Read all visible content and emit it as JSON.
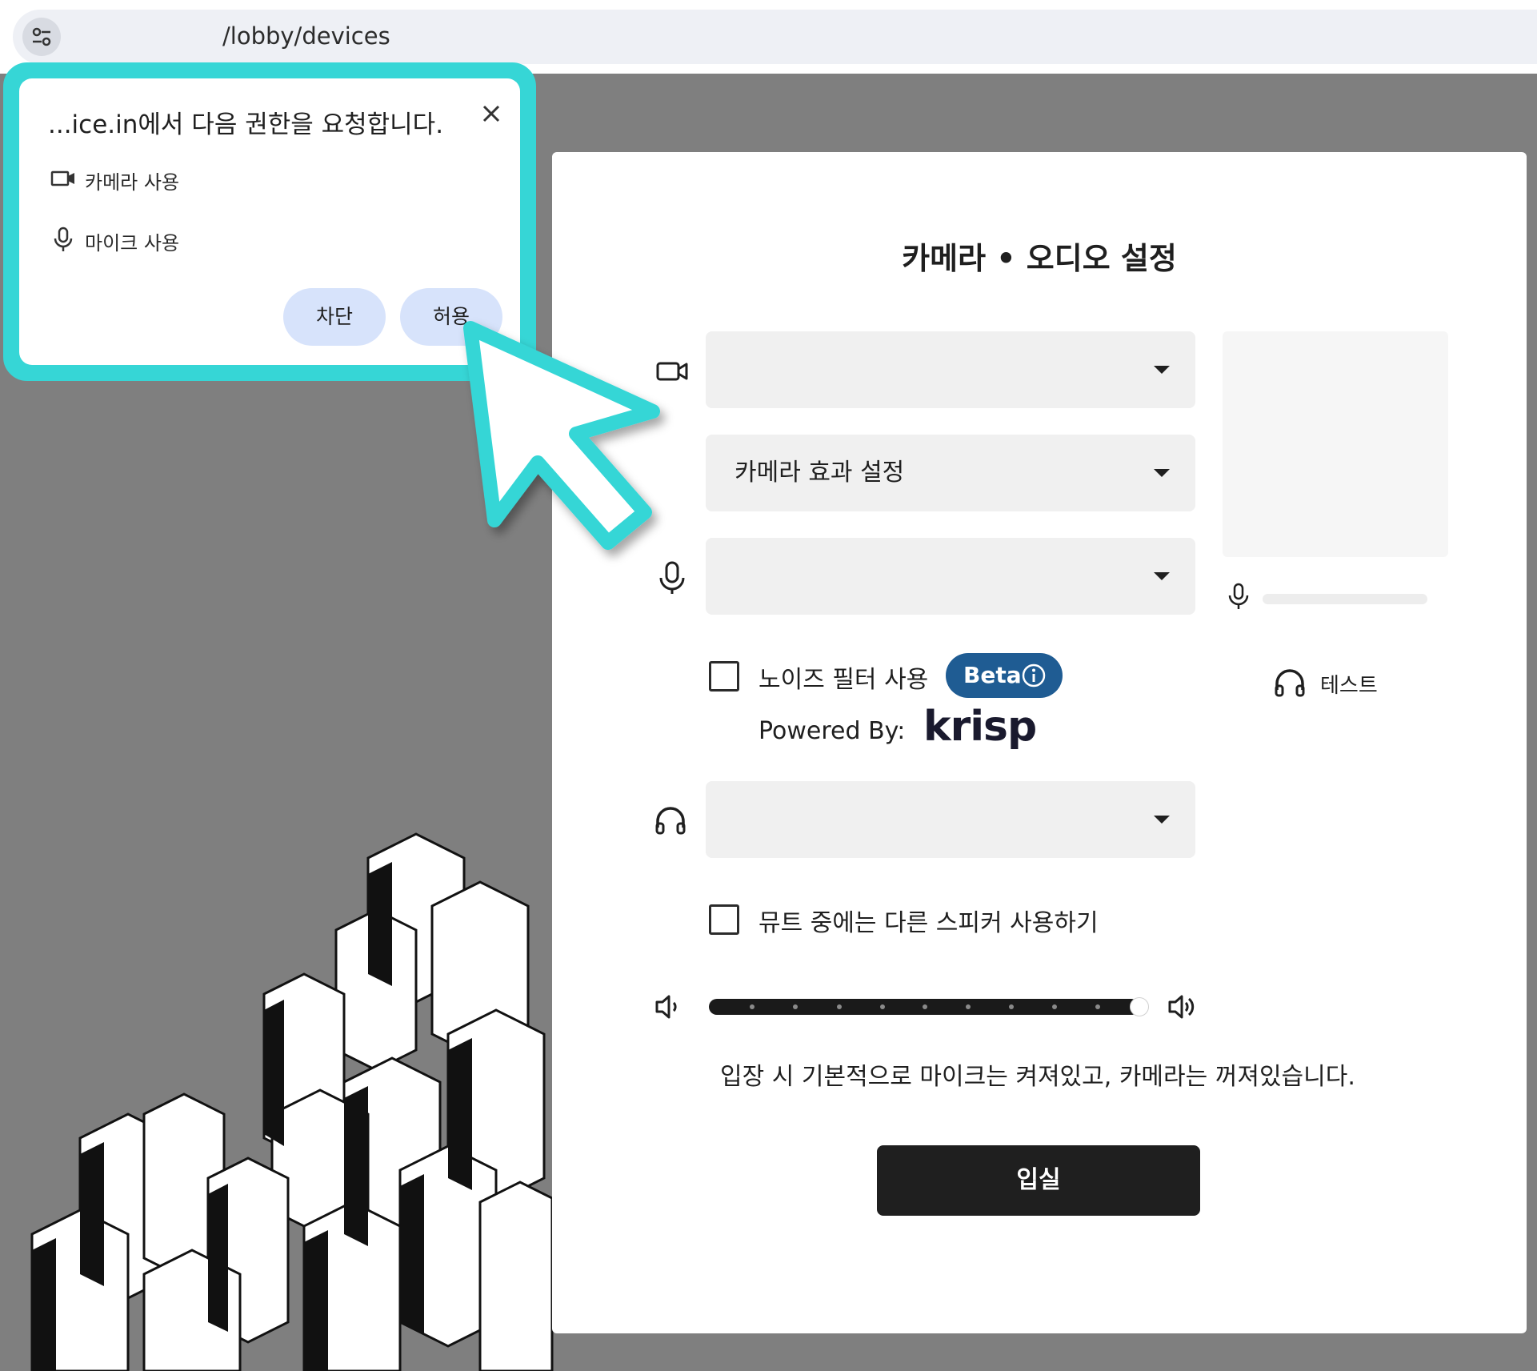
{
  "browser": {
    "url": "/lobby/devices"
  },
  "permission_popup": {
    "title": "...ice.in에서 다음 권한을 요청합니다.",
    "items": [
      {
        "label": "카메라 사용",
        "icon": "video-camera-icon"
      },
      {
        "label": "마이크 사용",
        "icon": "microphone-icon"
      }
    ],
    "block_label": "차단",
    "allow_label": "허용",
    "highlight_color": "#36d6d6"
  },
  "settings": {
    "title": "카메라 • 오디오 설정",
    "camera_select": {
      "value": ""
    },
    "camera_effect_select": {
      "value": "카메라 효과 설정"
    },
    "microphone_select": {
      "value": ""
    },
    "noise_filter": {
      "label": "노이즈 필터 사용",
      "checked": false,
      "badge": "Beta",
      "powered_by": "Powered By:",
      "brand": "krisp"
    },
    "speaker_select": {
      "value": ""
    },
    "speaker_test_label": "테스트",
    "mute_other_speaker": {
      "label": "뮤트 중에는 다른 스피커 사용하기",
      "checked": false
    },
    "volume_level": 1.0,
    "info_text": "입장 시 기본적으로 마이크는 켜져있고, 카메라는 꺼져있습니다.",
    "enter_label": "입실",
    "badge_color": "#1f5c93",
    "button_color": "#1f1f1f"
  }
}
